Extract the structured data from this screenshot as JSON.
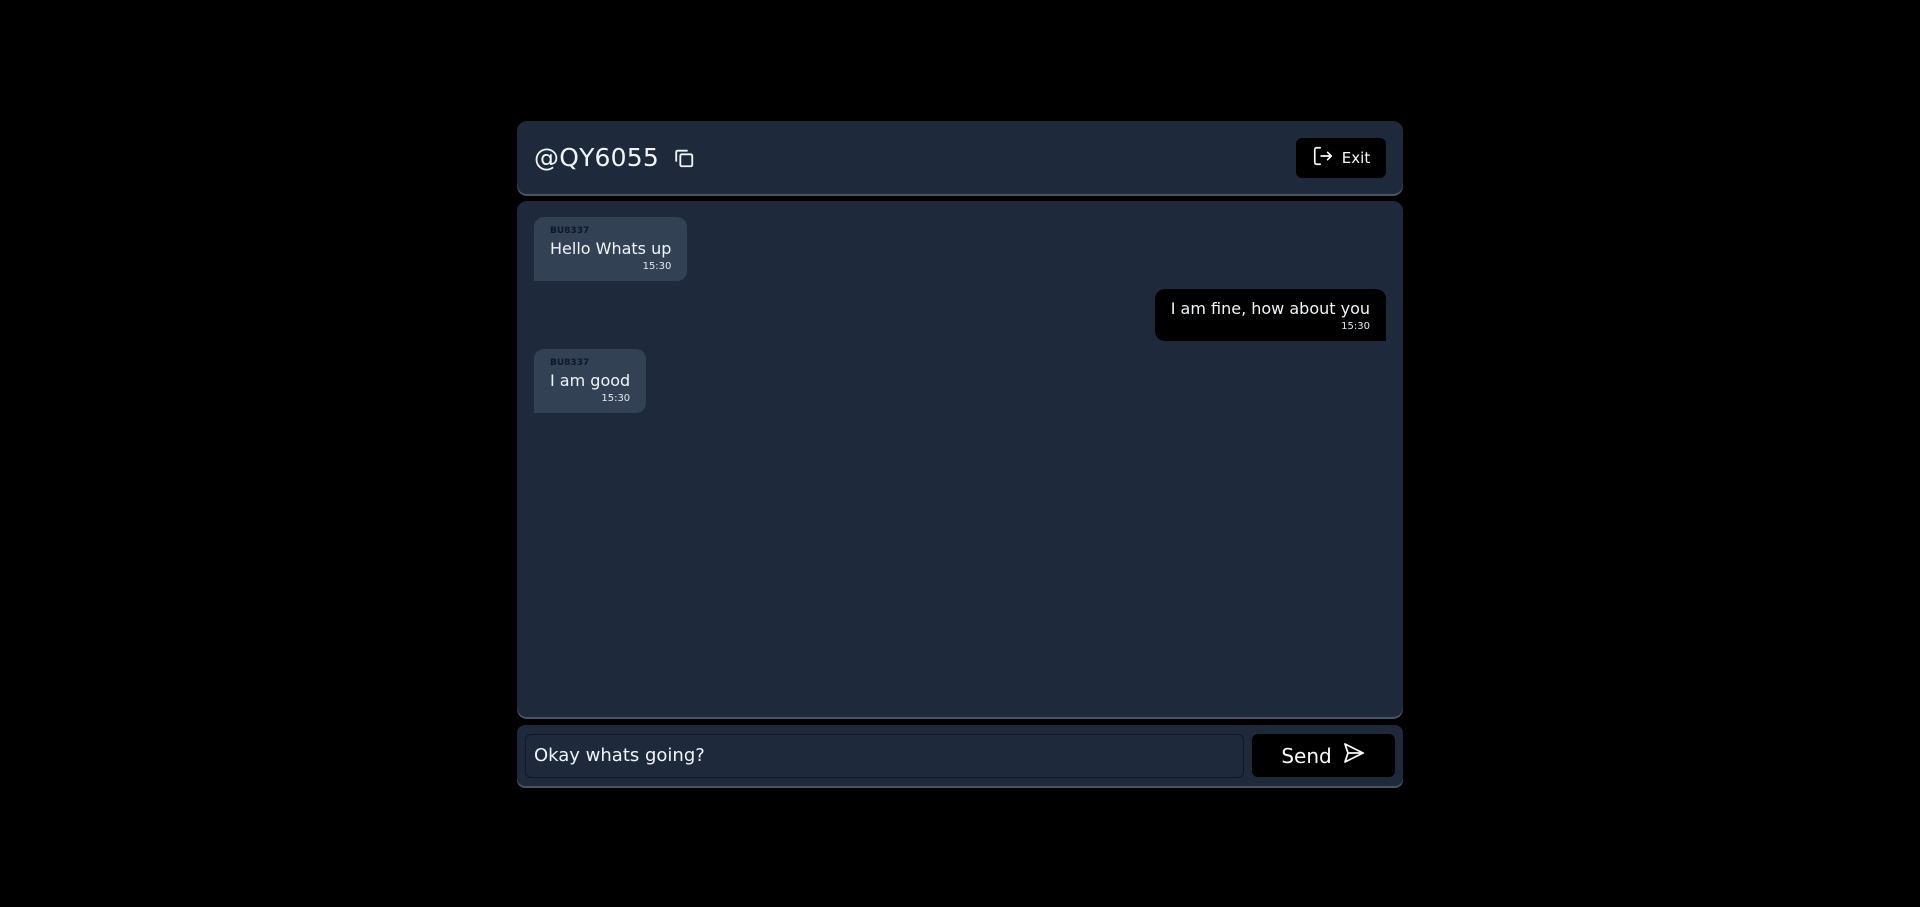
{
  "header": {
    "room_id": "@QY6055",
    "copy_icon": "copy-icon",
    "exit_label": "Exit",
    "exit_icon": "logout-icon"
  },
  "messages": [
    {
      "direction": "incoming",
      "sender": "BU8337",
      "text": "Hello Whats up",
      "time": "15:30"
    },
    {
      "direction": "outgoing",
      "text": "I am fine, how about you",
      "time": "15:30"
    },
    {
      "direction": "incoming",
      "sender": "BU8337",
      "text": "I am good",
      "time": "15:30"
    }
  ],
  "composer": {
    "input_value": "Okay whats going?",
    "send_label": "Send",
    "send_icon": "send-icon"
  },
  "colors": {
    "background": "#000000",
    "panel": "#1e293b",
    "incoming_bubble": "#334155",
    "outgoing_bubble": "#000000",
    "text": "#f1f5f9"
  }
}
